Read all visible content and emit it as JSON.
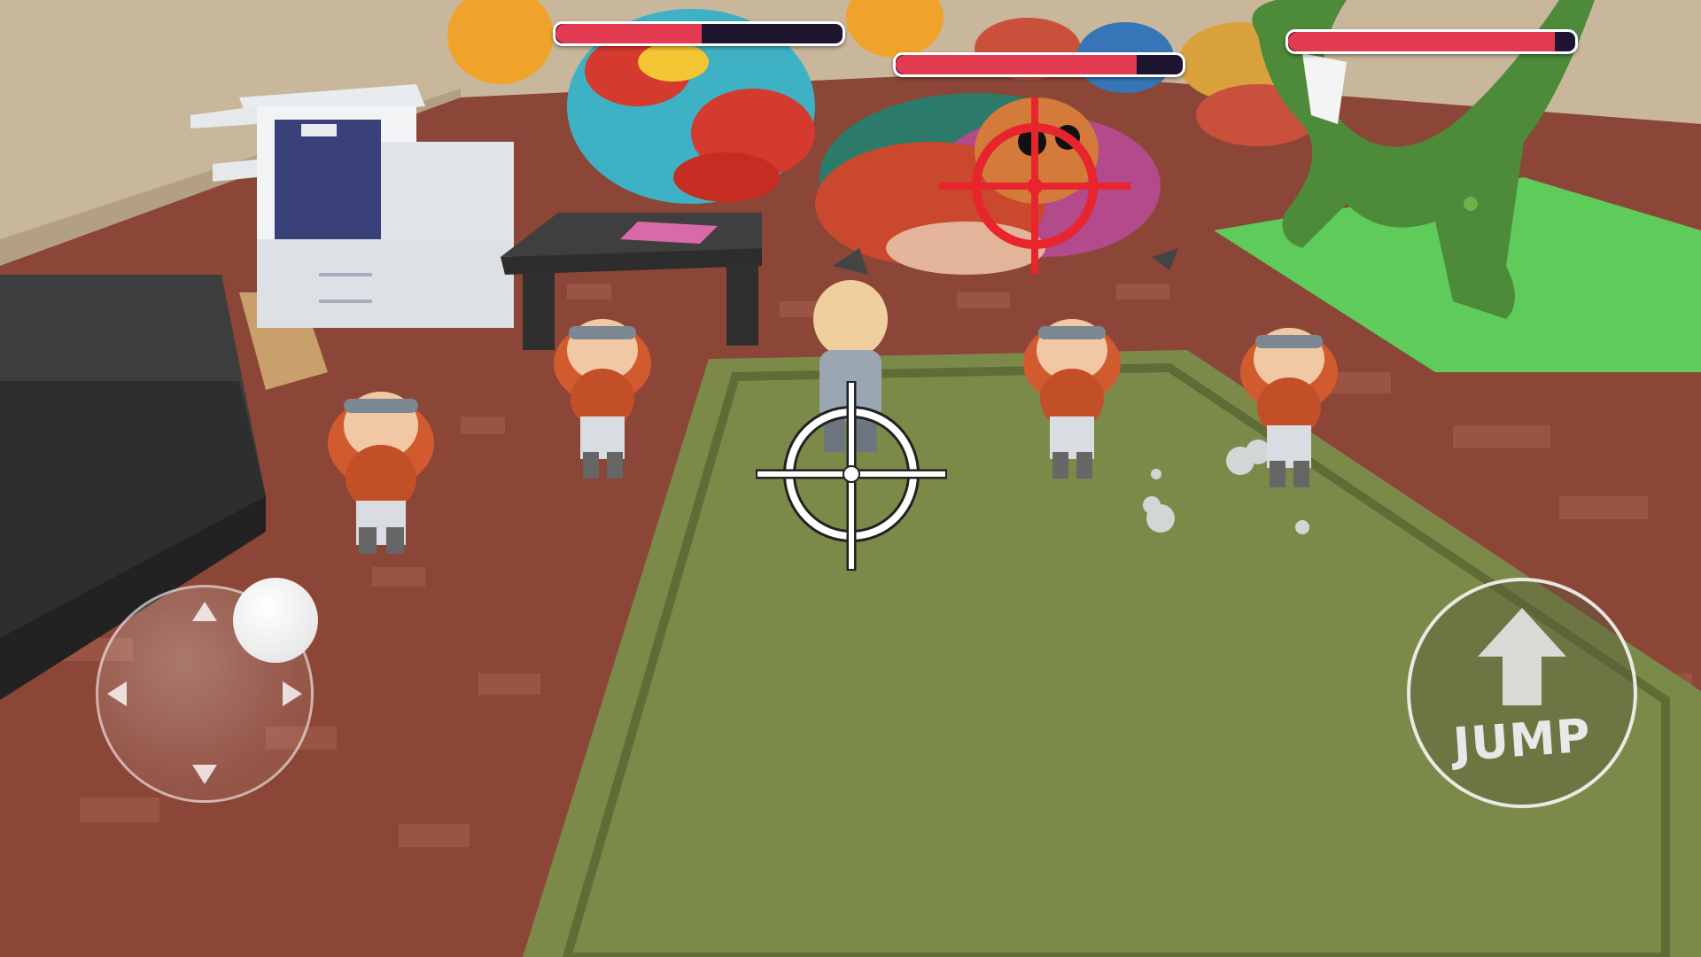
{
  "hud": {
    "enemy_health": [
      {
        "name_icon": "monster-health-bar",
        "fraction": 0.51
      },
      {
        "name_icon": "monster-health-bar",
        "fraction": 0.84
      },
      {
        "name_icon": "monster-health-bar",
        "fraction": 0.93
      }
    ],
    "jump_label": "JUMP",
    "icons": {
      "joystick": "joystick-icon",
      "jump_arrow": "up-arrow-icon",
      "crosshair_player": "crosshair-icon",
      "crosshair_target": "target-crosshair-icon"
    },
    "colors": {
      "health_fill": "#e23b52",
      "health_back": "#1e1530",
      "target_reticle": "#e8242c",
      "player_reticle": "#ffffff"
    }
  }
}
